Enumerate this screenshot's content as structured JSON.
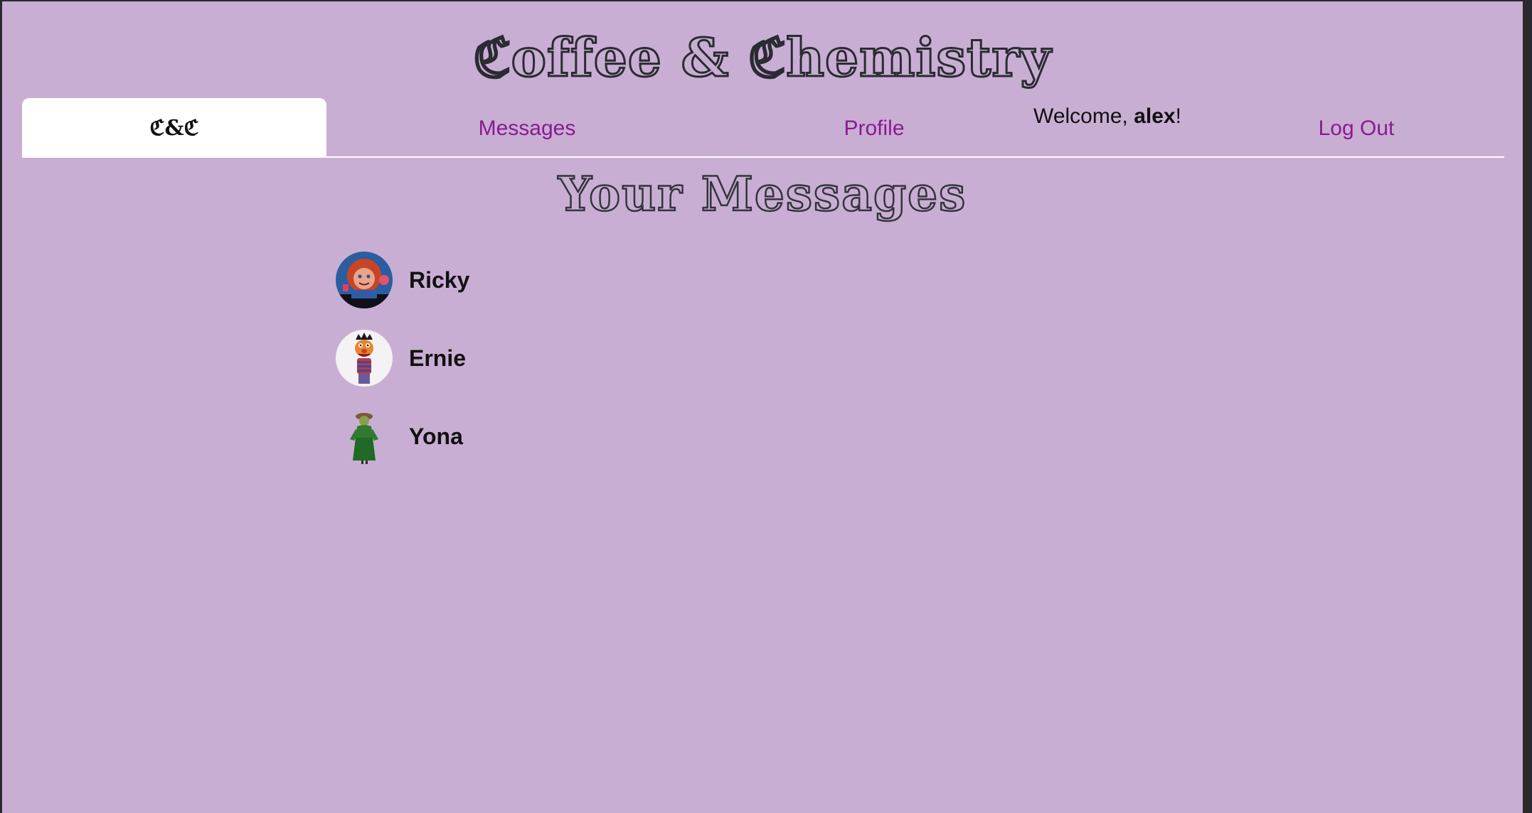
{
  "site": {
    "title": "ℭoffee & ℭhemistry"
  },
  "nav": {
    "home_label": "ℭ&ℭ",
    "messages_label": "Messages",
    "profile_label": "Profile",
    "welcome_prefix": "Welcome, ",
    "username": "alex",
    "welcome_suffix": "!",
    "logout_label": "Log Out"
  },
  "main": {
    "heading": "Your Messages",
    "conversations": [
      {
        "name": "Ricky",
        "avatar_icon": "chucky-doll-avatar"
      },
      {
        "name": "Ernie",
        "avatar_icon": "ernie-puppet-avatar"
      },
      {
        "name": "Yona",
        "avatar_icon": "green-dress-figure-avatar"
      }
    ]
  },
  "colors": {
    "background": "#c9aed4",
    "link": "#8b1a8f",
    "active_tab": "#ffffff",
    "text": "#111111"
  }
}
